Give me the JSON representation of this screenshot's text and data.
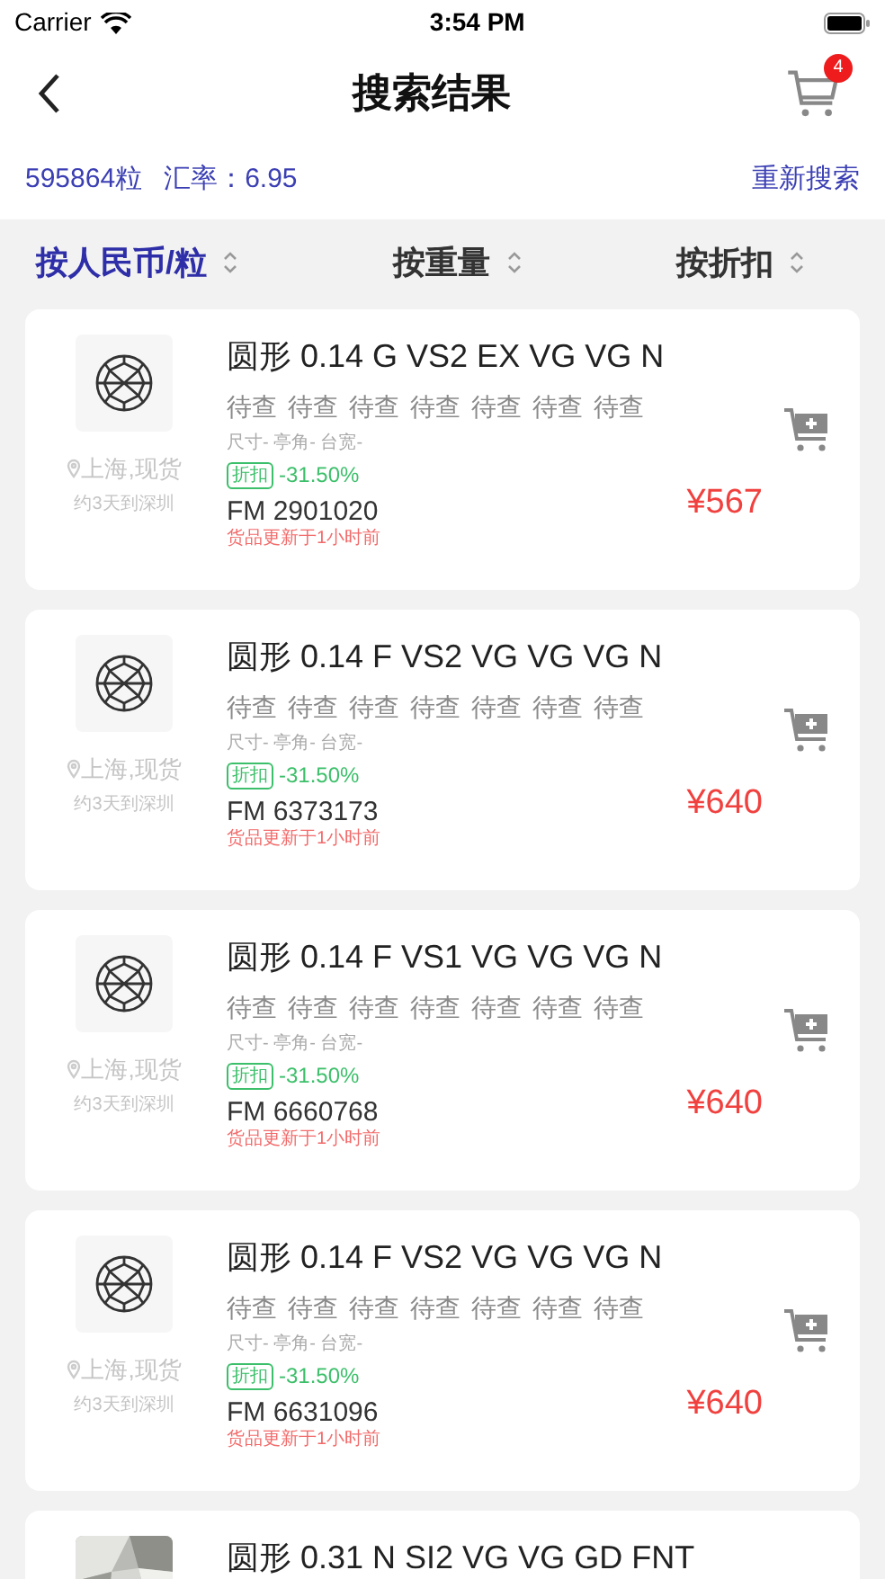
{
  "status_bar": {
    "carrier": "Carrier",
    "time": "3:54 PM"
  },
  "nav": {
    "title": "搜索结果",
    "cart_count": "4"
  },
  "summary": {
    "count": "595864粒",
    "rate": "汇率：6.95",
    "action": "重新搜索"
  },
  "sort_tabs": [
    {
      "label": "按人民币/粒",
      "selected": true
    },
    {
      "label": "按重量",
      "selected": false
    },
    {
      "label": "按折扣",
      "selected": false
    }
  ],
  "results": [
    {
      "thumb": {
        "kind": "icon"
      },
      "location": "上海,现货",
      "delivery": "约3天到深圳",
      "title": "圆形 0.14 G VS2 EX VG VG N",
      "checks": [
        "待查",
        "待查",
        "待查",
        "待查",
        "待查",
        "待查",
        "待查"
      ],
      "specs": "尺寸- 亭角- 台宽-",
      "discount_tag": "折扣",
      "discount": "-31.50%",
      "code": "FM 2901020",
      "updated": "货品更新于1小时前",
      "price": "¥567"
    },
    {
      "thumb": {
        "kind": "icon"
      },
      "location": "上海,现货",
      "delivery": "约3天到深圳",
      "title": "圆形 0.14 F VS2 VG VG VG N",
      "checks": [
        "待查",
        "待查",
        "待查",
        "待查",
        "待查",
        "待查",
        "待查"
      ],
      "specs": "尺寸- 亭角- 台宽-",
      "discount_tag": "折扣",
      "discount": "-31.50%",
      "code": "FM 6373173",
      "updated": "货品更新于1小时前",
      "price": "¥640"
    },
    {
      "thumb": {
        "kind": "icon"
      },
      "location": "上海,现货",
      "delivery": "约3天到深圳",
      "title": "圆形 0.14 F VS1 VG VG VG N",
      "checks": [
        "待查",
        "待查",
        "待查",
        "待查",
        "待查",
        "待查",
        "待查"
      ],
      "specs": "尺寸- 亭角- 台宽-",
      "discount_tag": "折扣",
      "discount": "-31.50%",
      "code": "FM 6660768",
      "updated": "货品更新于1小时前",
      "price": "¥640"
    },
    {
      "thumb": {
        "kind": "icon"
      },
      "location": "上海,现货",
      "delivery": "约3天到深圳",
      "title": "圆形 0.14 F VS2 VG VG VG N",
      "checks": [
        "待查",
        "待查",
        "待查",
        "待查",
        "待查",
        "待查",
        "待查"
      ],
      "specs": "尺寸- 亭角- 台宽-",
      "discount_tag": "折扣",
      "discount": "-31.50%",
      "code": "FM 6631096",
      "updated": "货品更新于1小时前",
      "price": "¥640"
    },
    {
      "title": "圆形 0.31 N SI2 VG VG GD FNT"
    }
  ]
}
